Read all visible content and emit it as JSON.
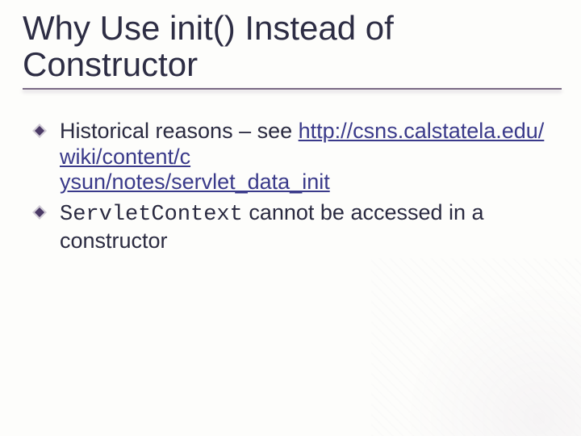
{
  "title_line1": "Why Use init() Instead of",
  "title_line2": "Constructor",
  "bullets": [
    {
      "pre": "Historical reasons – see ",
      "link": "http://csns.calstatela.edu/wiki/content/cysun/notes/servlet_data_init",
      "link_display_l1": "http://csns.calstatela.edu/wiki/content/c",
      "link_display_l2": "ysun/notes/servlet_data_init"
    },
    {
      "code": "ServletContext",
      "post": " cannot be accessed in a constructor"
    }
  ]
}
